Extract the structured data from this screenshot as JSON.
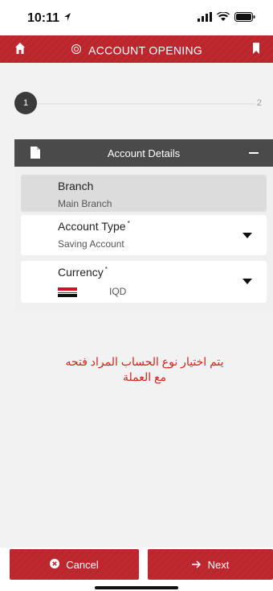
{
  "status_bar": {
    "time": "10:11"
  },
  "header": {
    "title": "ACCOUNT OPENING",
    "home_icon": "home-icon",
    "bookmark_icon": "bookmark-icon"
  },
  "stepper": {
    "step1_label": "1",
    "step2_label": "2"
  },
  "section": {
    "title": "Account Details"
  },
  "form": {
    "branch": {
      "label": "Branch",
      "value": "Main Branch"
    },
    "account_type": {
      "label": "Account Type",
      "required_mark": "*",
      "value": "Saving Account"
    },
    "currency": {
      "label": "Currency",
      "required_mark": "*",
      "value": "IQD"
    }
  },
  "annotation": {
    "line1": "يتم اختيار نوع الحساب المراد فتحه",
    "line2": "مع العملة"
  },
  "footer": {
    "cancel_label": "Cancel",
    "next_label": "Next"
  },
  "colors": {
    "brand_red": "#c0282f",
    "section_dark": "#4a4a4a",
    "annotation_red": "#d8201c"
  }
}
